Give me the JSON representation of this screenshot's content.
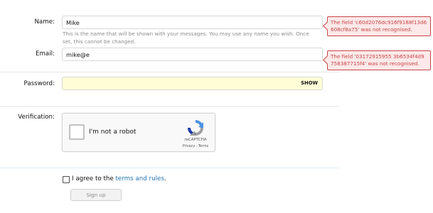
{
  "form": {
    "name_label": "Name:",
    "name_value": "Mike",
    "name_hint": "This is the name that will be shown with your messages. You may use any name you wish. Once set, this cannot be changed.",
    "email_label": "Email:",
    "email_value": "mike@e",
    "password_label": "Password:",
    "password_value": "",
    "password_toggle": "SHOW",
    "verification_label": "Verification:",
    "agree_prefix": "I agree to the ",
    "agree_link": "terms and rules",
    "agree_suffix": ".",
    "agree_checked": false,
    "signup_label": "Sign up"
  },
  "errors": {
    "name_error": "The field 'c60d2076dc916f9188f13d6608cf8a75' was not recognised.",
    "email_error": "The field '03172915955 3b6534f4d9758387715f4' was not recognised."
  },
  "captcha": {
    "checkbox_label": "I'm not a robot",
    "brand": "reCAPTCHA",
    "privacy": "Privacy",
    "separator": " - ",
    "terms": "Terms"
  },
  "colors": {
    "error_border": "#c84448",
    "error_background": "#fde9e9",
    "link": "#2577b1",
    "autofill_background": "#fefdd6"
  }
}
